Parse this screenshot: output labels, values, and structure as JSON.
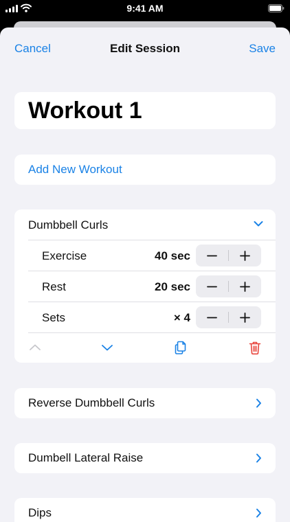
{
  "status_bar": {
    "time": "9:41 AM"
  },
  "nav": {
    "cancel": "Cancel",
    "title": "Edit Session",
    "save": "Save"
  },
  "workout": {
    "title": "Workout 1"
  },
  "add_button": "Add New Workout",
  "expanded_exercise": {
    "name": "Dumbbell Curls",
    "rows": [
      {
        "label": "Exercise",
        "value": "40 sec"
      },
      {
        "label": "Rest",
        "value": "20 sec"
      },
      {
        "label": "Sets",
        "value": "× 4"
      }
    ]
  },
  "collapsed_exercises": [
    {
      "name": "Reverse Dumbbell Curls"
    },
    {
      "name": "Dumbell Lateral Raise"
    },
    {
      "name": "Dips"
    }
  ],
  "colors": {
    "accent": "#1a82e6",
    "destructive": "#e8453c",
    "background": "#f2f2f7",
    "card": "#ffffff"
  }
}
